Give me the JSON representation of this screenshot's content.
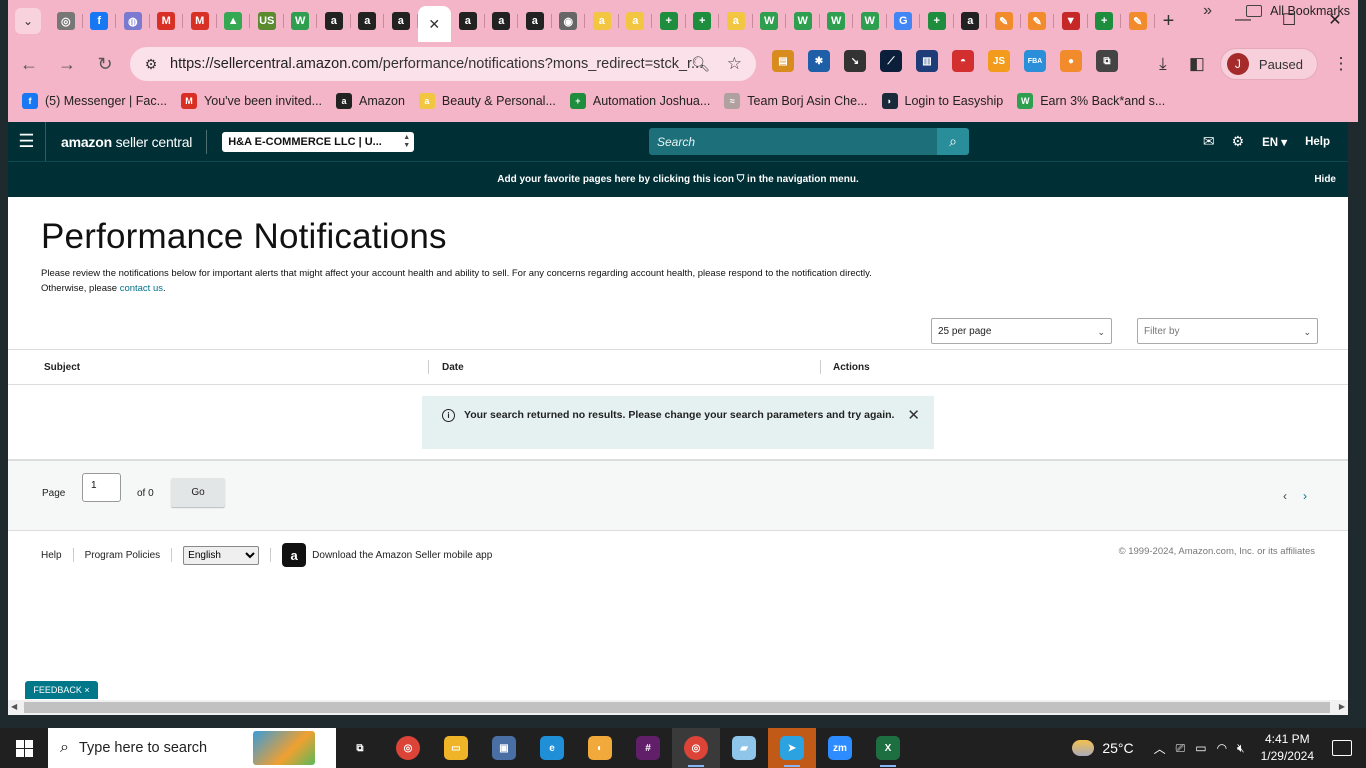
{
  "browser": {
    "tabs": [
      {
        "icon": "chrome-icon",
        "color": "#777777",
        "glyph": "◎"
      },
      {
        "icon": "facebook-icon",
        "color": "#1877f2",
        "glyph": "f"
      },
      {
        "icon": "globe-badge-icon",
        "color": "#7a7ad0",
        "glyph": "◍"
      },
      {
        "icon": "gmail-icon",
        "color": "#d93025",
        "glyph": "M"
      },
      {
        "icon": "gmail-icon",
        "color": "#d93025",
        "glyph": "M"
      },
      {
        "icon": "google-drive-icon",
        "color": "#34a853",
        "glyph": "▲"
      },
      {
        "icon": "usfoods-icon",
        "color": "#5b8a2f",
        "glyph": "US"
      },
      {
        "icon": "helium-icon",
        "color": "#2e9e4f",
        "glyph": "W"
      },
      {
        "icon": "amazon-icon",
        "color": "#222222",
        "glyph": "a"
      },
      {
        "icon": "amazon-icon",
        "color": "#222222",
        "glyph": "a"
      },
      {
        "icon": "amazon-icon",
        "color": "#222222",
        "glyph": "a"
      },
      {
        "icon": "close-icon",
        "color": "#333333",
        "glyph": "✕",
        "active": true
      },
      {
        "icon": "amazon-icon",
        "color": "#222222",
        "glyph": "a"
      },
      {
        "icon": "amazon-icon",
        "color": "#222222",
        "glyph": "a"
      },
      {
        "icon": "amazon-icon",
        "color": "#222222",
        "glyph": "a"
      },
      {
        "icon": "globe-icon",
        "color": "#666666",
        "glyph": "◉"
      },
      {
        "icon": "amazon-smile-icon",
        "color": "#f3c642",
        "glyph": "a"
      },
      {
        "icon": "amazon-smile-icon",
        "color": "#f3c642",
        "glyph": "a"
      },
      {
        "icon": "sheets-icon",
        "color": "#1e8e3e",
        "glyph": "+"
      },
      {
        "icon": "sheets-icon",
        "color": "#1e8e3e",
        "glyph": "+"
      },
      {
        "icon": "amazon-smile-icon",
        "color": "#f3c642",
        "glyph": "a"
      },
      {
        "icon": "helium-icon",
        "color": "#2e9e4f",
        "glyph": "W"
      },
      {
        "icon": "helium-icon",
        "color": "#2e9e4f",
        "glyph": "W"
      },
      {
        "icon": "helium-icon",
        "color": "#2e9e4f",
        "glyph": "W"
      },
      {
        "icon": "helium-icon",
        "color": "#2e9e4f",
        "glyph": "W"
      },
      {
        "icon": "google-icon",
        "color": "#4285f4",
        "glyph": "G"
      },
      {
        "icon": "sheets-icon",
        "color": "#1e8e3e",
        "glyph": "+"
      },
      {
        "icon": "amazon-icon",
        "color": "#222222",
        "glyph": "a"
      },
      {
        "icon": "pencil-icon",
        "color": "#f28b2c",
        "glyph": "✎"
      },
      {
        "icon": "pencil-icon",
        "color": "#f28b2c",
        "glyph": "✎"
      },
      {
        "icon": "filter-icon",
        "color": "#c62828",
        "glyph": "▼"
      },
      {
        "icon": "sheets-icon",
        "color": "#1e8e3e",
        "glyph": "+"
      },
      {
        "icon": "pencil-icon",
        "color": "#f28b2c",
        "glyph": "✎"
      }
    ],
    "url_host": "https://sellercentral.amazon.com",
    "url_path": "/performance/notifications?mons_redirect=stck_r...",
    "extensions": [
      {
        "icon": "cake-extension-icon",
        "color": "#d98c1e",
        "glyph": "▤"
      },
      {
        "icon": "blue-gear-extension-icon",
        "color": "#1e5fa8",
        "glyph": "✱"
      },
      {
        "icon": "arrow-extension-icon",
        "color": "#333333",
        "glyph": "↘"
      },
      {
        "icon": "chart-extension-icon",
        "color": "#0b1f3a",
        "glyph": "⟋"
      },
      {
        "icon": "stats-extension-icon",
        "color": "#1d3c78",
        "glyph": "▥"
      },
      {
        "icon": "pokeball-extension-icon",
        "color": "#d32f2f",
        "glyph": "◓"
      },
      {
        "icon": "js-extension-icon",
        "color": "#f29b1d",
        "glyph": "JS"
      },
      {
        "icon": "fba-extension-icon",
        "color": "#2a8fd8",
        "glyph": "FBA"
      },
      {
        "icon": "orange-circle-extension-icon",
        "color": "#f28b2c",
        "glyph": "●"
      },
      {
        "icon": "puzzle-extension-icon",
        "color": "#444444",
        "glyph": "⧉"
      }
    ],
    "profile_initial": "J",
    "profile_label": "Paused",
    "bookmarks": [
      {
        "label": "(5) Messenger | Fac...",
        "icon": "facebook-icon",
        "color": "#1877f2",
        "glyph": "f"
      },
      {
        "label": "You've been invited...",
        "icon": "gmail-icon",
        "color": "#d93025",
        "glyph": "M"
      },
      {
        "label": "Amazon",
        "icon": "amazon-icon",
        "color": "#222222",
        "glyph": "a"
      },
      {
        "label": "Beauty & Personal...",
        "icon": "amazon-smile-icon",
        "color": "#f3c642",
        "glyph": "a"
      },
      {
        "label": "Automation Joshua...",
        "icon": "sheets-icon",
        "color": "#1e8e3e",
        "glyph": "+"
      },
      {
        "label": "Team Borj Asin Che...",
        "icon": "team-icon",
        "color": "#b0a0a0",
        "glyph": "≈"
      },
      {
        "label": "Login to Easyship",
        "icon": "easyship-icon",
        "color": "#1a2a3a",
        "glyph": "◗"
      },
      {
        "label": "Earn 3% Back*and s...",
        "icon": "helium-icon",
        "color": "#2e9e4f",
        "glyph": "W"
      }
    ],
    "all_bookmarks": "All Bookmarks"
  },
  "header": {
    "logo_bold": "amazon",
    "logo_rest": " seller central",
    "account": "H&A E-COMMERCE LLC | U...",
    "search_placeholder": "Search",
    "lang": "EN ▾",
    "help": "Help"
  },
  "fav_bar": {
    "message_before": "Add your favorite pages here by clicking this icon",
    "message_after": "in the navigation menu.",
    "hide": "Hide"
  },
  "main": {
    "title": "Performance Notifications",
    "description": "Please review the notifications below for important alerts that might affect your account health and ability to sell. For any concerns regarding account health, please respond to the notification directly. Otherwise, please ",
    "contact_link": "contact us",
    "description_end": ".",
    "per_page": "25 per page",
    "filter_placeholder": "Filter by",
    "columns": [
      "Subject",
      "Date",
      "Actions"
    ],
    "no_results": "Your search returned no results. Please change your search parameters and try again."
  },
  "pager": {
    "page_label": "Page",
    "page_value": "1",
    "of_label": "of 0",
    "go_label": "Go"
  },
  "footer": {
    "help": "Help",
    "program_policies": "Program Policies",
    "language": "English",
    "app_text": "Download the Amazon Seller mobile app",
    "copyright": "© 1999-2024, Amazon.com, Inc. or its affiliates"
  },
  "feedback": "FEEDBACK ×",
  "taskbar": {
    "search_placeholder": "Type here to search",
    "apps": [
      {
        "icon": "task-view-icon",
        "color": "#202020",
        "glyph": "⧉",
        "on": false
      },
      {
        "icon": "chrome-icon",
        "color": "#db4437",
        "glyph": "◎",
        "on": false
      },
      {
        "icon": "file-explorer-icon",
        "color": "#f0b429",
        "glyph": "▭",
        "on": false
      },
      {
        "icon": "devices-icon",
        "color": "#4a6fa5",
        "glyph": "▣",
        "on": false
      },
      {
        "icon": "edge-icon",
        "color": "#1f8fd8",
        "glyph": "e",
        "on": false
      },
      {
        "icon": "vpn-icon",
        "color": "#f2a93b",
        "glyph": "◐",
        "on": false
      },
      {
        "icon": "slack-icon",
        "color": "#611f69",
        "glyph": "#",
        "on": false
      },
      {
        "icon": "chrome-profile-icon",
        "color": "#db4437",
        "glyph": "◎",
        "on": true,
        "active": true
      },
      {
        "icon": "notepad-icon",
        "color": "#8ec5e8",
        "glyph": "▰",
        "on": false
      },
      {
        "icon": "telegram-icon",
        "color": "#2aa3e0",
        "glyph": "➤",
        "on": true,
        "orange": true
      },
      {
        "icon": "zoom-icon",
        "color": "#2d8cff",
        "glyph": "zm",
        "on": false
      },
      {
        "icon": "excel-icon",
        "color": "#1d6f42",
        "glyph": "X",
        "on": true
      }
    ],
    "temperature": "25°C",
    "time": "4:41 PM",
    "date": "1/29/2024"
  }
}
